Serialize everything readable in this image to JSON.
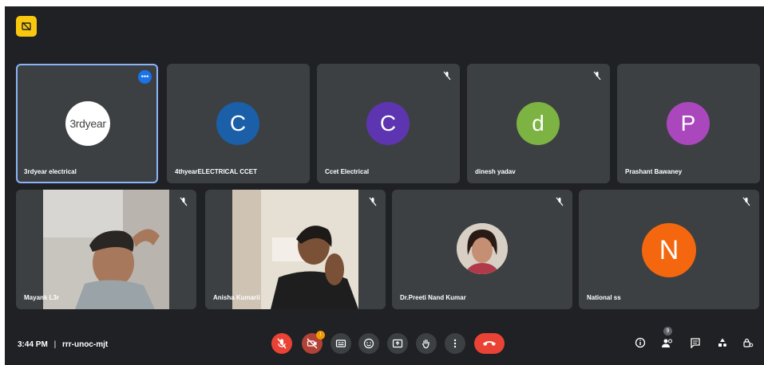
{
  "participants_row1": [
    {
      "name": "3rdyear electrical",
      "avatar_text": "3rdyear",
      "avatar_color": "#ffffff"
    },
    {
      "name": "4thyearELECTRICAL CCET",
      "avatar_letter": "C",
      "avatar_color": "#1a5fa8"
    },
    {
      "name": "Ccet Electrical",
      "avatar_letter": "C",
      "avatar_color": "#5e35b1"
    },
    {
      "name": "dinesh yadav",
      "avatar_letter": "d",
      "avatar_color": "#7cb342"
    },
    {
      "name": "Prashant Bawaney",
      "avatar_letter": "P",
      "avatar_color": "#ab47bc"
    }
  ],
  "participants_row2": [
    {
      "name": "Mayank L3r"
    },
    {
      "name": "Anisha Kumarii"
    },
    {
      "name": "Dr.Preeti Nand Kumar"
    },
    {
      "name": "National ss",
      "avatar_letter": "N",
      "avatar_color": "#f4670e"
    }
  ],
  "bottom_bar": {
    "time": "3:44 PM",
    "separator": "|",
    "meeting_code": "rrr-unoc-mjt",
    "camera_badge": "!",
    "people_badge": "9"
  },
  "icons": [
    "presenting-icon",
    "mic-off-icon",
    "more-options-icon",
    "mic-off-icon",
    "camera-off-icon",
    "captions-icon",
    "emoji-icon",
    "present-screen-icon",
    "raise-hand-icon",
    "more-vert-icon",
    "end-call-icon",
    "info-icon",
    "people-icon",
    "chat-icon",
    "activities-icon",
    "host-controls-icon"
  ],
  "colors": {
    "background": "#202124",
    "tile": "#3c4043",
    "accent": "#1a73e8",
    "end_call": "#ea4335",
    "badge": "#f9c90f"
  }
}
